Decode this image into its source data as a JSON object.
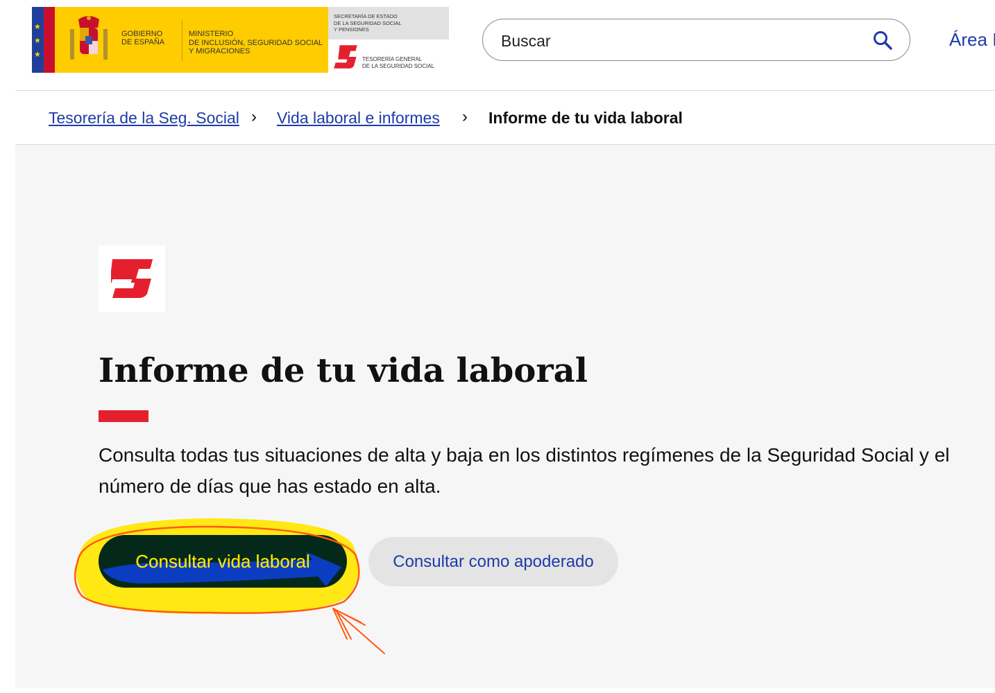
{
  "header": {
    "gov_line1": "GOBIERNO",
    "gov_line2": "DE ESPAÑA",
    "ministry_line1": "MINISTERIO",
    "ministry_line2": "DE INCLUSIÓN, SEGURIDAD SOCIAL",
    "ministry_line3": "Y MIGRACIONES",
    "secretaria_line1": "SECRETARÍA DE ESTADO",
    "secretaria_line2": "DE LA SEGURIDAD SOCIAL",
    "secretaria_line3": "Y PENSIONES",
    "tgss_line1": "TESORERÍA GENERAL",
    "tgss_line2": "DE LA SEGURIDAD SOCIAL",
    "search_placeholder": "Buscar",
    "area_link": "Área I"
  },
  "breadcrumb": {
    "items": [
      {
        "label": "Tesorería de la Seg. Social",
        "link": true
      },
      {
        "label": "Vida laboral e informes ",
        "link": true
      },
      {
        "label": "Informe de tu vida laboral",
        "link": false
      }
    ]
  },
  "main": {
    "title": "Informe de tu vida laboral",
    "description": "Consulta todas tus situaciones de alta y baja en los distintos regímenes de la Seguridad Social y el número de días que has estado en alta.",
    "primary_button": "Consultar vida laboral",
    "secondary_button": "Consultar como apoderado"
  },
  "colors": {
    "brand_red": "#e5202e",
    "link_blue": "#1d3ba8",
    "primary_button_bg": "#04291a",
    "highlight_yellow": "#ffe600",
    "annotation_orange": "#ff5a14"
  },
  "icons": {
    "search": "search-icon",
    "breadcrumb_separator": "chevron-right-icon",
    "tgss": "tgss-logo-icon"
  }
}
